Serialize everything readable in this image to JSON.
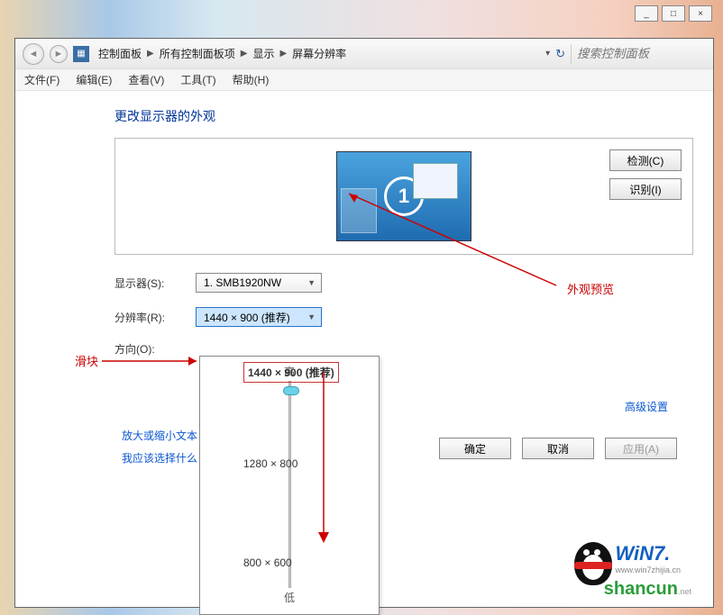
{
  "window_controls": {
    "minimize": "_",
    "maximize": "□",
    "close": "×"
  },
  "breadcrumb": {
    "items": [
      "控制面板",
      "所有控制面板项",
      "显示",
      "屏幕分辨率"
    ]
  },
  "search": {
    "placeholder": "搜索控制面板"
  },
  "menu": {
    "file": "文件(F)",
    "edit": "编辑(E)",
    "view": "查看(V)",
    "tools": "工具(T)",
    "help": "帮助(H)"
  },
  "page": {
    "title": "更改显示器的外观"
  },
  "preview": {
    "detect_btn": "检测(C)",
    "identify_btn": "识别(I)",
    "monitor_number": "1"
  },
  "form": {
    "display_label": "显示器(S):",
    "display_value": "1. SMB1920NW",
    "resolution_label": "分辨率(R):",
    "resolution_value": "1440 × 900 (推荐)",
    "orientation_label": "方向(O):"
  },
  "slider": {
    "high": "高",
    "low": "低",
    "opt_current": "1440 × 900 (推荐)",
    "opt_mid": "1280 × 800",
    "opt_low": "800 × 600"
  },
  "annotations": {
    "preview_label": "外观预览",
    "slider_label": "滑块"
  },
  "links": {
    "advanced": "高级设置",
    "zoom_text": "放大或缩小文本",
    "which_choose": "我应该选择什么"
  },
  "actions": {
    "ok": "确定",
    "cancel": "取消",
    "apply": "应用(A)"
  },
  "watermark": {
    "brand1": "WiN7.",
    "brand1_sub": "www.win7zhijia.cn",
    "brand2": "shancun",
    "brand2_sub": ".net"
  }
}
